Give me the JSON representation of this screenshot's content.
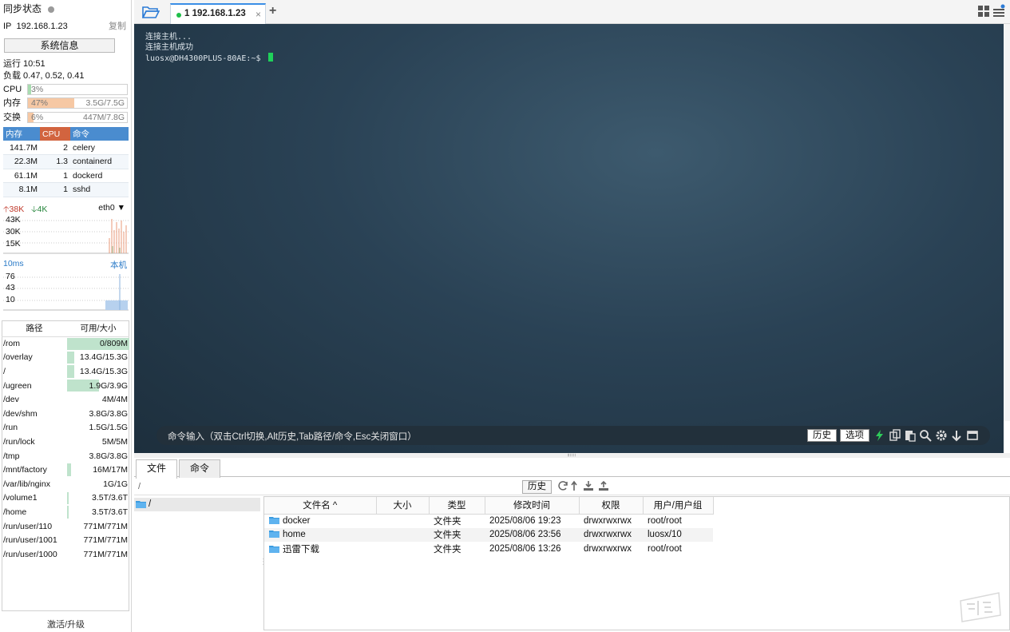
{
  "sidebar": {
    "sync_title": "同步状态",
    "ip_label": "IP",
    "ip_value": "192.168.1.23",
    "copy_label": "复制",
    "sysinfo_button": "系统信息",
    "uptime": "运行 10:51",
    "load": "负载 0.47, 0.52, 0.41",
    "cpu": {
      "label": "CPU",
      "percent_text": "3%",
      "fraction": 0.03,
      "value_text": ""
    },
    "mem": {
      "label": "内存",
      "percent_text": "47%",
      "fraction": 0.47,
      "value_text": "3.5G/7.5G"
    },
    "swap": {
      "label": "交换",
      "percent_text": "6%",
      "fraction": 0.06,
      "value_text": "447M/7.8G"
    },
    "process_headers": [
      "内存",
      "CPU",
      "命令"
    ],
    "processes": [
      {
        "mem": "141.7M",
        "cpu": "2",
        "cmd": "celery"
      },
      {
        "mem": "22.3M",
        "cpu": "1.3",
        "cmd": "containerd"
      },
      {
        "mem": "61.1M",
        "cpu": "1",
        "cmd": "dockerd"
      },
      {
        "mem": "8.1M",
        "cpu": "1",
        "cmd": "sshd"
      }
    ],
    "net": {
      "up": "38K",
      "down": "4K",
      "interface": "eth0",
      "ticks": [
        "43K",
        "30K",
        "15K"
      ]
    },
    "latency": {
      "value": "10ms",
      "target": "本机",
      "ticks": [
        "76",
        "43",
        "10"
      ]
    },
    "disk_headers": [
      "路径",
      "可用/大小"
    ],
    "disks": [
      {
        "path": "/rom",
        "value": "0/809M",
        "used": 1.0
      },
      {
        "path": "/overlay",
        "value": "13.4G/15.3G",
        "used": 0.12
      },
      {
        "path": "/",
        "value": "13.4G/15.3G",
        "used": 0.12
      },
      {
        "path": "/ugreen",
        "value": "1.9G/3.9G",
        "used": 0.51
      },
      {
        "path": "/dev",
        "value": "4M/4M",
        "used": 0.0
      },
      {
        "path": "/dev/shm",
        "value": "3.8G/3.8G",
        "used": 0.0
      },
      {
        "path": "/run",
        "value": "1.5G/1.5G",
        "used": 0.0
      },
      {
        "path": "/run/lock",
        "value": "5M/5M",
        "used": 0.0
      },
      {
        "path": "/tmp",
        "value": "3.8G/3.8G",
        "used": 0.0
      },
      {
        "path": "/mnt/factory",
        "value": "16M/17M",
        "used": 0.06
      },
      {
        "path": "/var/lib/nginx",
        "value": "1G/1G",
        "used": 0.0
      },
      {
        "path": "/volume1",
        "value": "3.5T/3.6T",
        "used": 0.03
      },
      {
        "path": "/home",
        "value": "3.5T/3.6T",
        "used": 0.03
      },
      {
        "path": "/run/user/110",
        "value": "771M/771M",
        "used": 0.0
      },
      {
        "path": "/run/user/1001",
        "value": "771M/771M",
        "used": 0.0
      },
      {
        "path": "/run/user/1000",
        "value": "771M/771M",
        "used": 0.0
      }
    ],
    "upgrade_label": "激活/升级"
  },
  "tabs": {
    "session_label": "1 192.168.1.23",
    "close_glyph": "×",
    "add_glyph": "+"
  },
  "terminal": {
    "lines": [
      "连接主机...",
      "连接主机成功",
      "luosx@DH4300PLUS-80AE:~$ "
    ],
    "command_hint": "命令输入（双击Ctrl切换,Alt历史,Tab路径/命令,Esc关闭窗口）",
    "history_button": "历史",
    "options_button": "选项"
  },
  "bottom": {
    "tabs": [
      "文件",
      "命令"
    ],
    "path": "/",
    "history_button": "历史",
    "tree_root": "/",
    "file_headers": [
      "文件名 ^",
      "大小",
      "类型",
      "修改时间",
      "权限",
      "用户/用户组"
    ],
    "files": [
      {
        "name": "docker",
        "size": "",
        "type": "文件夹",
        "mtime": "2025/08/06 19:23",
        "perm": "drwxrwxrwx",
        "owner": "root/root"
      },
      {
        "name": "home",
        "size": "",
        "type": "文件夹",
        "mtime": "2025/08/06 23:56",
        "perm": "drwxrwxrwx",
        "owner": "luosx/10"
      },
      {
        "name": "迅雷下载",
        "size": "",
        "type": "文件夹",
        "mtime": "2025/08/06 13:26",
        "perm": "drwxrwxrwx",
        "owner": "root/root"
      }
    ]
  },
  "colors": {
    "accent": "#3a8ee6",
    "mem_header": "#4a8ccf",
    "cpu_header": "#d2643f",
    "cpu_fill": "#a8dcb0",
    "mem_fill": "#f6c8a4",
    "swap_fill": "#f6c8a4",
    "disk_fill": "#bfe3cc",
    "terminal_bg": "#2a4255",
    "cursor": "#1fd15a"
  }
}
